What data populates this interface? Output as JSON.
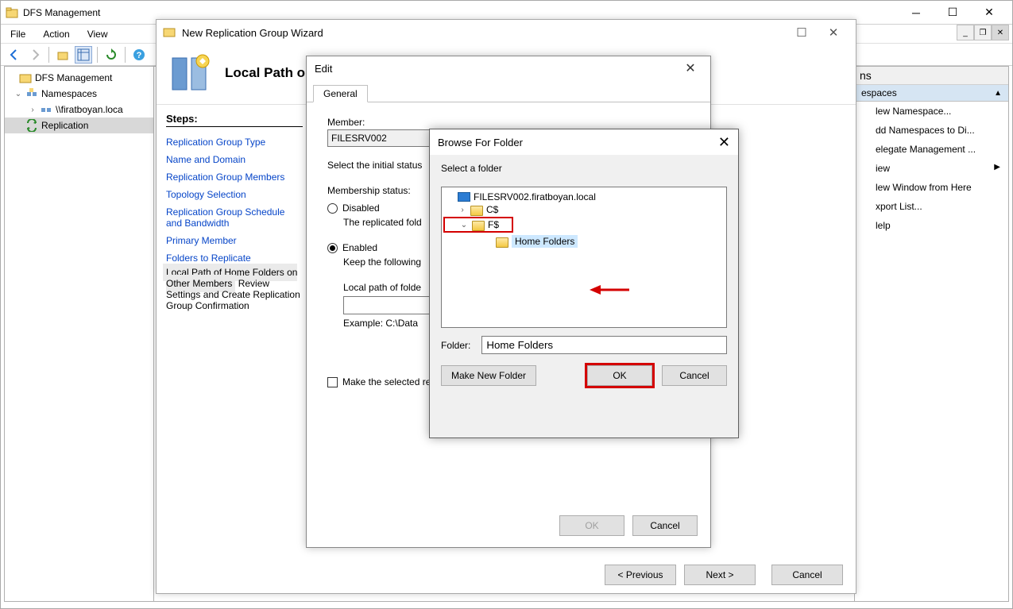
{
  "main": {
    "title": "DFS Management",
    "menus": [
      "File",
      "Action",
      "View"
    ],
    "tree": {
      "root": "DFS Management",
      "namespaces": "Namespaces",
      "ns_item": "\\\\firatboyan.loca",
      "replication": "Replication"
    }
  },
  "actions": {
    "header": "ns",
    "group": "espaces",
    "items": [
      "lew Namespace...",
      "dd Namespaces to Di...",
      "elegate Management ...",
      "iew",
      "lew Window from Here",
      "xport List...",
      "lelp"
    ]
  },
  "wizard": {
    "title": "New Replication Group Wizard",
    "page_title": "Local Path o",
    "steps_header": "Steps:",
    "steps": [
      "Replication Group Type",
      "Name and Domain",
      "Replication Group Members",
      "Topology Selection",
      "Replication Group Schedule and Bandwidth",
      "Primary Member",
      "Folders to Replicate"
    ],
    "current_step": "Local Path of Home Folders on Other Members",
    "next_steps": [
      "Review Settings and Create Replication Group",
      "Confirmation"
    ],
    "btn_prev": "<  Previous",
    "btn_next": "Next  >",
    "btn_cancel": "Cancel"
  },
  "edit": {
    "title": "Edit",
    "tab": "General",
    "member_label": "Member:",
    "member_value": "FILESRV002",
    "initial_status": "Select the initial status",
    "membership_status": "Membership status:",
    "disabled": "Disabled",
    "disabled_desc": "The replicated fold",
    "enabled": "Enabled",
    "enabled_desc": "Keep the following",
    "local_path_label": "Local path of folde",
    "example": "Example: C:\\Data",
    "readonly": "Make the selected replicated folder on this member read only.",
    "btn_ok": "OK",
    "btn_cancel": "Cancel"
  },
  "browse": {
    "title": "Browse For Folder",
    "prompt": "Select a folder",
    "tree": {
      "server": "FILESRV002.firatboyan.local",
      "c": "C$",
      "f": "F$",
      "home": "Home Folders"
    },
    "folder_label": "Folder:",
    "folder_value": "Home Folders",
    "btn_make": "Make New Folder",
    "btn_ok": "OK",
    "btn_cancel": "Cancel"
  }
}
